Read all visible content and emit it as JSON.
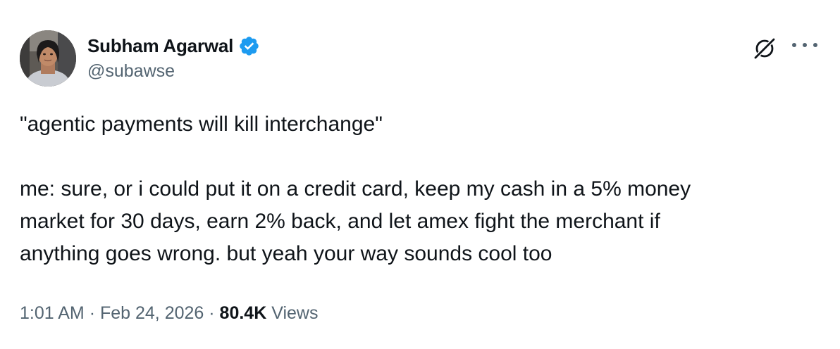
{
  "author": {
    "display_name": "Subham Agarwal",
    "handle": "@subawse",
    "verified": true,
    "verified_color": "#1d9bf0"
  },
  "actions": {
    "grok_icon": "grok-icon",
    "more_icon": "more-icon"
  },
  "tweet": {
    "line1": "\"agentic payments will kill interchange\"",
    "line2": "me: sure, or i could put it on a credit card, keep my cash in a 5% money",
    "line3": "market for 30 days, earn 2% back, and let amex fight the merchant if",
    "line4": "anything goes wrong. but yeah your way sounds cool too"
  },
  "meta": {
    "time": "1:01 AM",
    "separator": "·",
    "date": "Feb 24, 2026",
    "views_count": "80.4K",
    "views_label": "Views"
  },
  "colors": {
    "text_primary": "#0f1419",
    "text_secondary": "#536471"
  }
}
